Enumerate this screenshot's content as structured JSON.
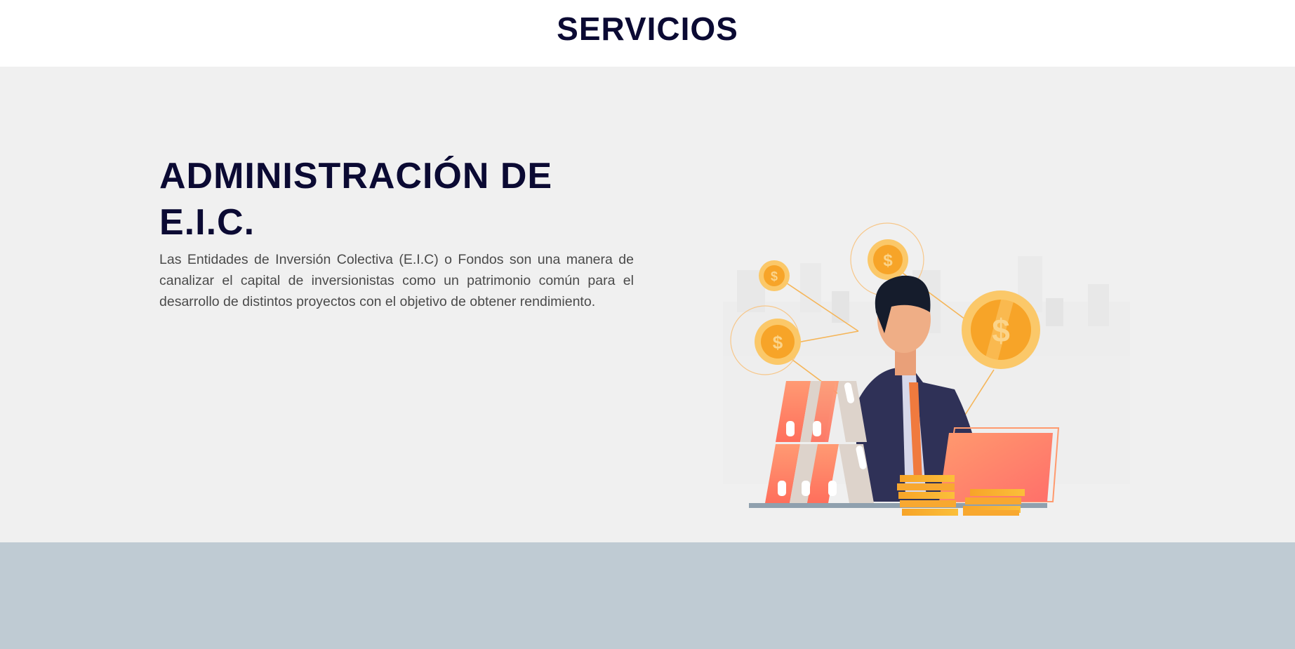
{
  "header": {
    "title": "SERVICIOS"
  },
  "service": {
    "title_line1": "ADMINISTRACIÓN DE",
    "title_line2": "E.I.C.",
    "description": "Las Entidades de Inversión Colectiva (E.I.C) o Fondos son una manera de canalizar el capital de inversionistas como un patrimonio común para el desarrollo de distintos proyectos con el objetivo de obtener rendimiento."
  },
  "illustration": {
    "icon": "businessman-coins-illustration",
    "coin_symbol": "$"
  },
  "colors": {
    "title": "#0b0a33",
    "section_bg": "#f0f0f0",
    "bottom_band": "#bfcbd3",
    "coin": "#f7a428",
    "accent": "#ff7a5c"
  }
}
